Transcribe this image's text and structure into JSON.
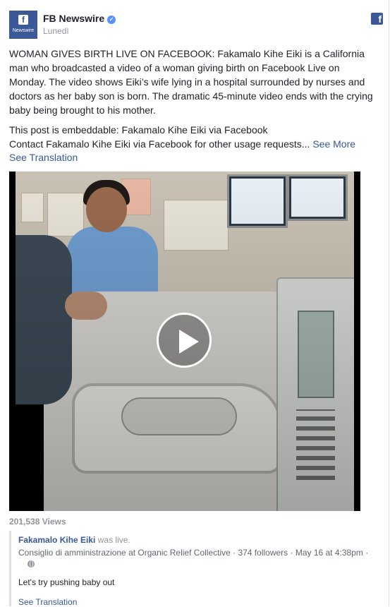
{
  "page": {
    "name": "FB Newswire",
    "date": "Lunedì",
    "avatar_text": "Newswire"
  },
  "post": {
    "paragraph1": "WOMAN GIVES BIRTH LIVE ON FACEBOOK: Fakamalo Kihe Eiki is a California man who broadcasted a video of a woman giving birth on Facebook Live on Monday. The video shows Eiki’s wife lying in a hospital surrounded by nurses and doctors as her baby son is born. The dramatic 45-minute video ends with the crying baby being brought to his mother.",
    "line2": "This post is embeddable: Fakamalo Kihe Eiki via Facebook",
    "line3": "Contact Fakamalo Kihe Eiki via Facebook for other usage requests...",
    "see_more": "See More",
    "see_translation": "See Translation"
  },
  "video": {
    "views": "201,538 Views"
  },
  "comment": {
    "author": "Fakamalo Kihe Eiki",
    "status": "was live.",
    "meta": "Consiglio di amministrazione at Organic Relief Collective · 374 followers · May 16 at 4:38pm ·",
    "text": "Let's try pushing baby out",
    "see_translation": "See Translation"
  },
  "icons": {
    "facebook": "facebook-logo-icon",
    "verified": "verified-badge-icon",
    "play": "play-icon",
    "globe": "globe-icon"
  },
  "colors": {
    "brand": "#3b5998",
    "link": "#365899",
    "muted": "#90949c"
  }
}
